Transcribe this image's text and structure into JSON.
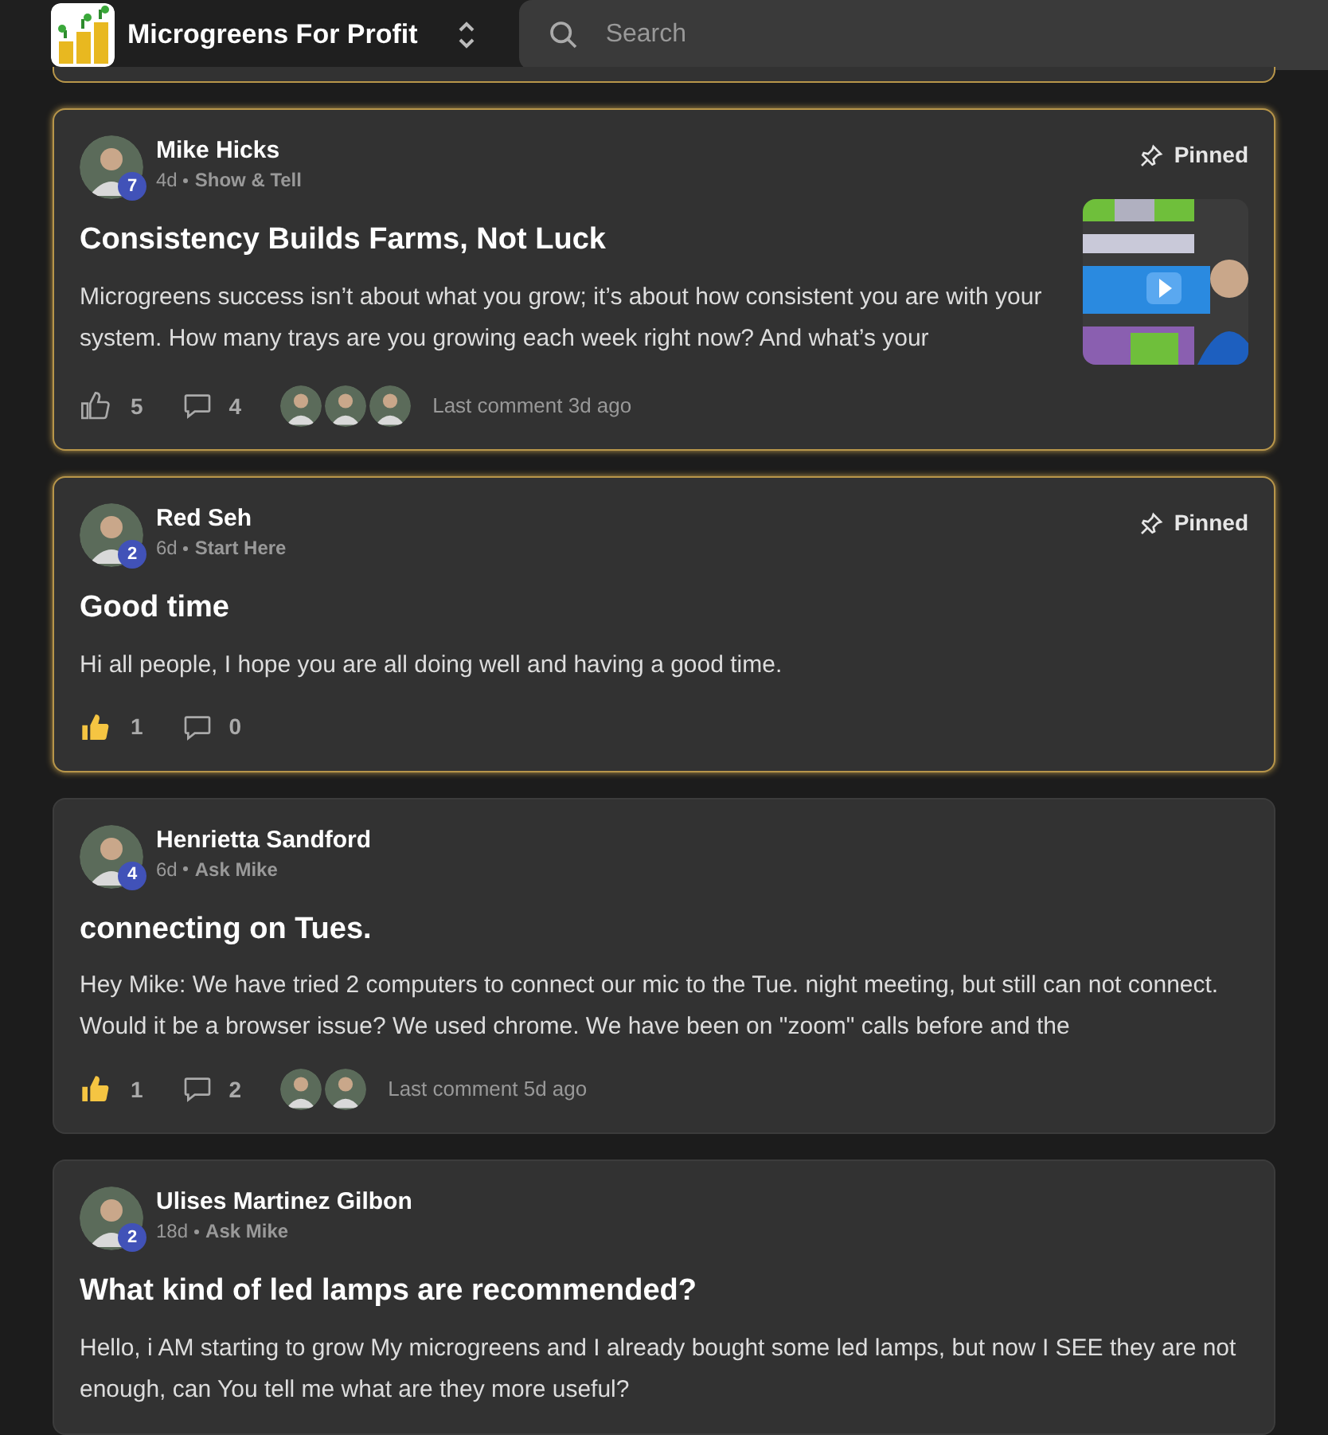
{
  "header": {
    "title": "Microgreens For Profit",
    "search": {
      "placeholder": "Search"
    }
  },
  "posts": [
    {
      "author": "Mike Hicks",
      "level": "7",
      "age": "4d",
      "category": "Show & Tell",
      "pinned": true,
      "pinned_label": "Pinned",
      "title": "Consistency Builds Farms, Not Luck",
      "body": "Microgreens success isn’t about what you grow; it’s about how consistent you are with your system. How many trays are you growing each week right now? And what’s your",
      "thumbnail": {
        "kind": "picture"
      },
      "liked": false,
      "likes": "5",
      "comments": "4",
      "commenters": [
        {
          "kind": "avatar"
        },
        {
          "kind": "avatar"
        },
        {
          "kind": "avatar"
        }
      ],
      "last_comment": "Last comment 3d ago"
    },
    {
      "author": "Red Seh",
      "level": "2",
      "age": "6d",
      "category": "Start Here",
      "pinned": true,
      "pinned_label": "Pinned",
      "title": "Good time",
      "body": "Hi all people, I hope you are all doing well and having a good time.",
      "liked": true,
      "likes": "1",
      "comments": "0"
    },
    {
      "author": "Henrietta Sandford",
      "level": "4",
      "age": "6d",
      "category": "Ask Mike",
      "pinned": false,
      "title": "connecting on Tues.",
      "body": "Hey Mike: We have tried 2 computers to connect our mic to the Tue. night meeting, but still can not connect. Would it be a browser issue? We used chrome. We have been on \"zoom\" calls before and the",
      "liked": true,
      "likes": "1",
      "comments": "2",
      "commenters": [
        {
          "kind": "avatar"
        },
        {
          "kind": "avatar"
        }
      ],
      "last_comment": "Last comment 5d ago"
    },
    {
      "author": "Ulises Martinez Gilbon",
      "level": "2",
      "age": "18d",
      "category": "Ask Mike",
      "pinned": false,
      "title": "What kind of led lamps are recommended?",
      "body": "Hello, i AM starting to grow My microgreens and I already bought some led lamps, but now I SEE they are not enough, can You tell me what are they more useful?"
    }
  ]
}
